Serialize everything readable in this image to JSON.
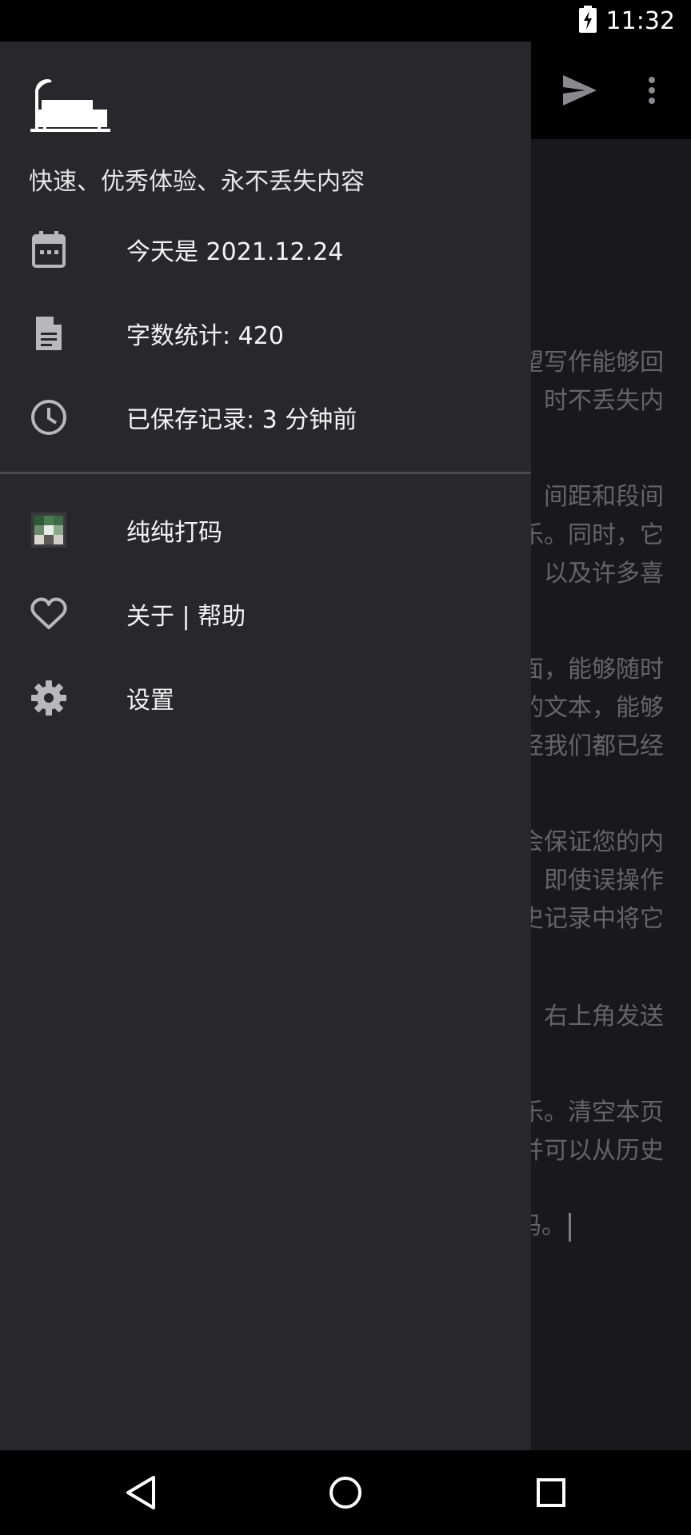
{
  "status_bar": {
    "time": "11:32",
    "battery_icon": "battery-charging-icon"
  },
  "toolbar": {
    "send_icon": "send-icon",
    "more_icon": "more-vert-icon"
  },
  "editor": {
    "paragraphs": [
      [
        "望写作能够回",
        "时不丢失内"
      ],
      [
        "间距和段间",
        "乐。同时，它",
        "，以及许多喜"
      ],
      [
        "面，能够随时",
        "的文本，能够",
        "经我们都已经"
      ],
      [
        "会保证您的内",
        "即使误操作",
        "史记录中将它"
      ],
      [
        "右上角发送"
      ],
      [
        "乐。清空本页",
        "并可以从历史"
      ],
      [
        "码。"
      ]
    ]
  },
  "drawer": {
    "subtitle": "快速、优秀体验、永不丢失内容",
    "info_items": [
      {
        "icon": "calendar-icon",
        "label": "今天是 2021.12.24"
      },
      {
        "icon": "document-icon",
        "label": "字数统计: 420"
      },
      {
        "icon": "clock-icon",
        "label": "已保存记录: 3 分钟前"
      }
    ],
    "menu_items": [
      {
        "icon": "app-logo-icon",
        "label": "纯纯打码"
      },
      {
        "icon": "heart-icon",
        "label": "关于 | 帮助"
      },
      {
        "icon": "gear-icon",
        "label": "设置"
      }
    ]
  },
  "nav_bar": {
    "back_icon": "back-triangle-icon",
    "home_icon": "home-circle-icon",
    "recents_icon": "recents-square-icon"
  },
  "colors": {
    "drawer_bg": "#28272b",
    "editor_bg": "#1f1f21",
    "editor_text": "#7c7c80",
    "icon": "#b8b8bc"
  }
}
